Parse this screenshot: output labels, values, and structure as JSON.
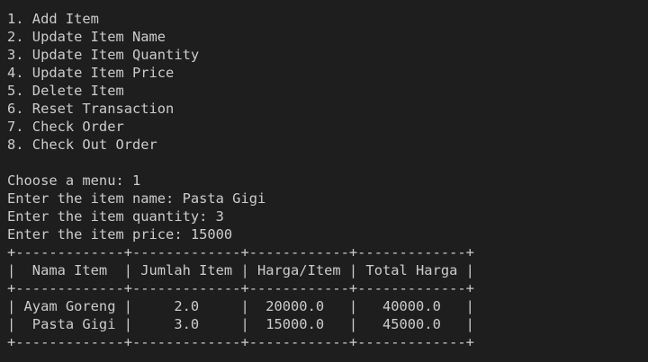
{
  "terminal": {
    "menu": [
      "1. Add Item",
      "2. Update Item Name",
      "3. Update Item Quantity",
      "4. Update Item Price",
      "5. Delete Item",
      "6. Reset Transaction",
      "7. Check Order",
      "8. Check Out Order"
    ],
    "prompts": [
      "Choose a menu: 1",
      "Enter the item name: Pasta Gigi",
      "Enter the item quantity: 3",
      "Enter the item price: 15000"
    ],
    "table": {
      "border_top": "+-------------+-------------+------------+-------------+",
      "header": "|  Nama Item  | Jumlah Item | Harga/Item | Total Harga |",
      "border_mid": "+-------------+-------------+------------+-------------+",
      "rows": [
        "| Ayam Goreng |     2.0     |  20000.0   |   40000.0   |",
        "|  Pasta Gigi |     3.0     |  15000.0   |   45000.0   |"
      ],
      "border_bottom": "+-------------+-------------+------------+-------------+"
    }
  }
}
